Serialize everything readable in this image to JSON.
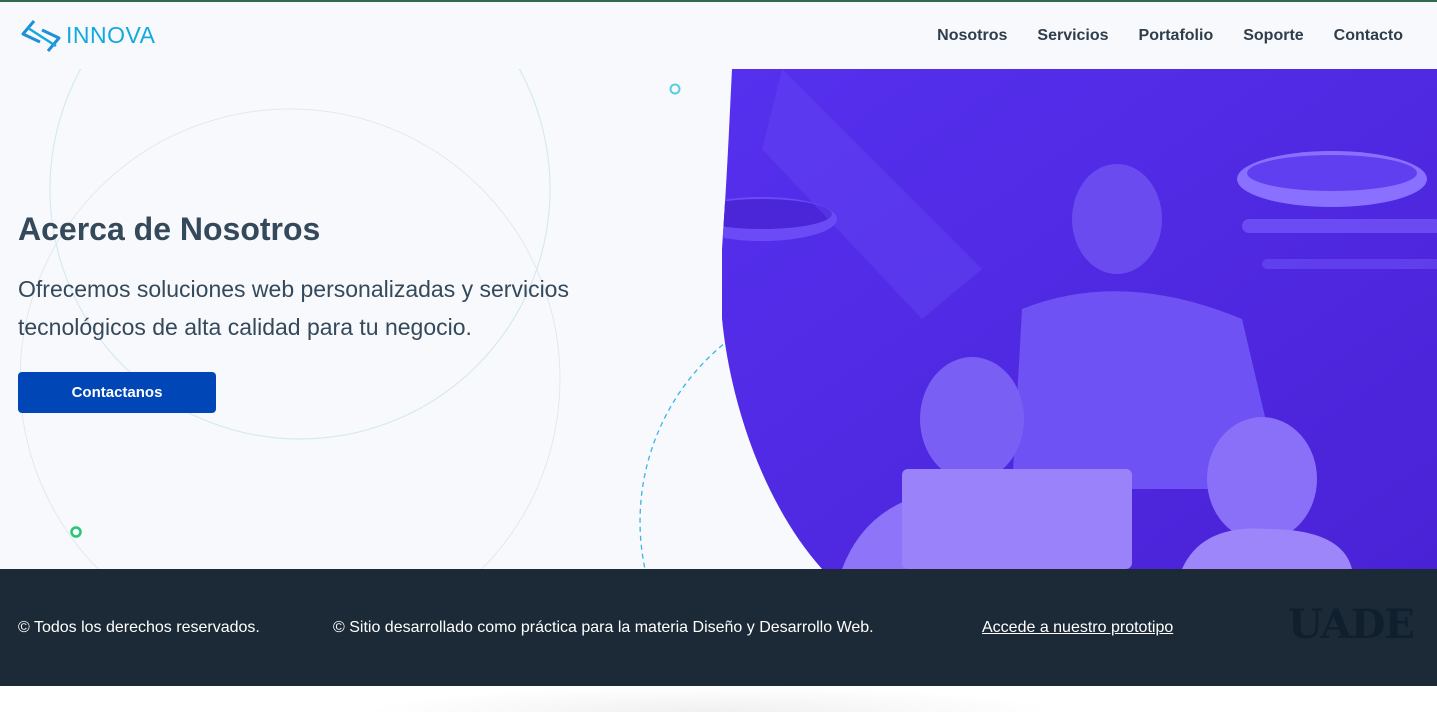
{
  "brand": {
    "name": "INNOVA"
  },
  "nav": {
    "items": [
      "Nosotros",
      "Servicios",
      "Portafolio",
      "Soporte",
      "Contacto"
    ]
  },
  "hero": {
    "title": "Acerca de Nosotros",
    "subtitle_line1": "Ofrecemos soluciones web personalizadas y servicios",
    "subtitle_line2": "tecnológicos de alta calidad para tu negocio.",
    "cta_label": "Contactanos",
    "image_description": "team-photo"
  },
  "footer": {
    "rights": "© Todos los derechos reservados.",
    "credit": "© Sitio desarrollado como práctica para la materia Diseño y Desarrollo Web.",
    "prototype_link": "Accede a nuestro prototipo",
    "logo": "UADE"
  },
  "colors": {
    "accent": "#0046b7",
    "brand": "#14a9de",
    "footer_bg": "#1b2a36",
    "photo_tint": "#5a2ff0"
  }
}
